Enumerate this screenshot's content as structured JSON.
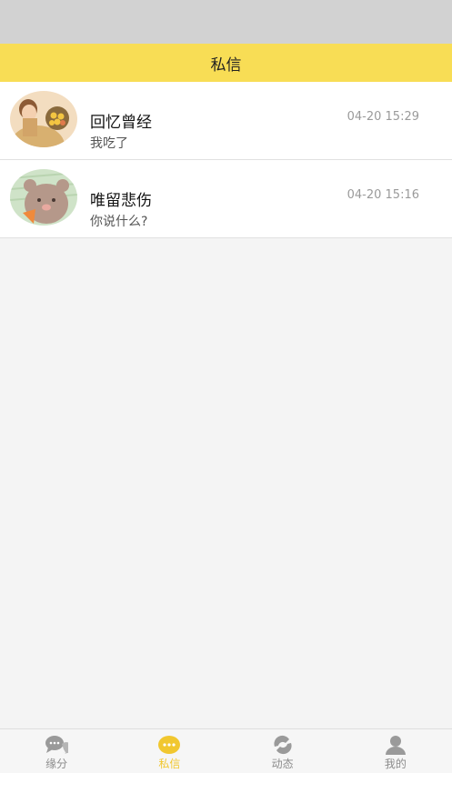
{
  "header": {
    "title": "私信"
  },
  "conversations": [
    {
      "name": "回忆曾经",
      "preview": "我吃了",
      "time": "04-20 15:29",
      "avatar": "avatar-boy-holding-flowers"
    },
    {
      "name": "唯留悲伤",
      "preview": "你说什么?",
      "time": "04-20 15:16",
      "avatar": "avatar-cartoon-bear"
    }
  ],
  "tabbar": {
    "tabs": [
      {
        "label": "缘分",
        "icon": "chat-bubbles-icon",
        "active": false
      },
      {
        "label": "私信",
        "icon": "message-dots-icon",
        "active": true
      },
      {
        "label": "动态",
        "icon": "swirl-icon",
        "active": false
      },
      {
        "label": "我的",
        "icon": "person-icon",
        "active": false
      }
    ]
  },
  "colors": {
    "accent": "#f8dd55",
    "active_tab": "#f1c72f",
    "inactive_tab": "#8c8c8c",
    "status_bar": "#d2d2d2",
    "background": "#f4f4f4"
  }
}
